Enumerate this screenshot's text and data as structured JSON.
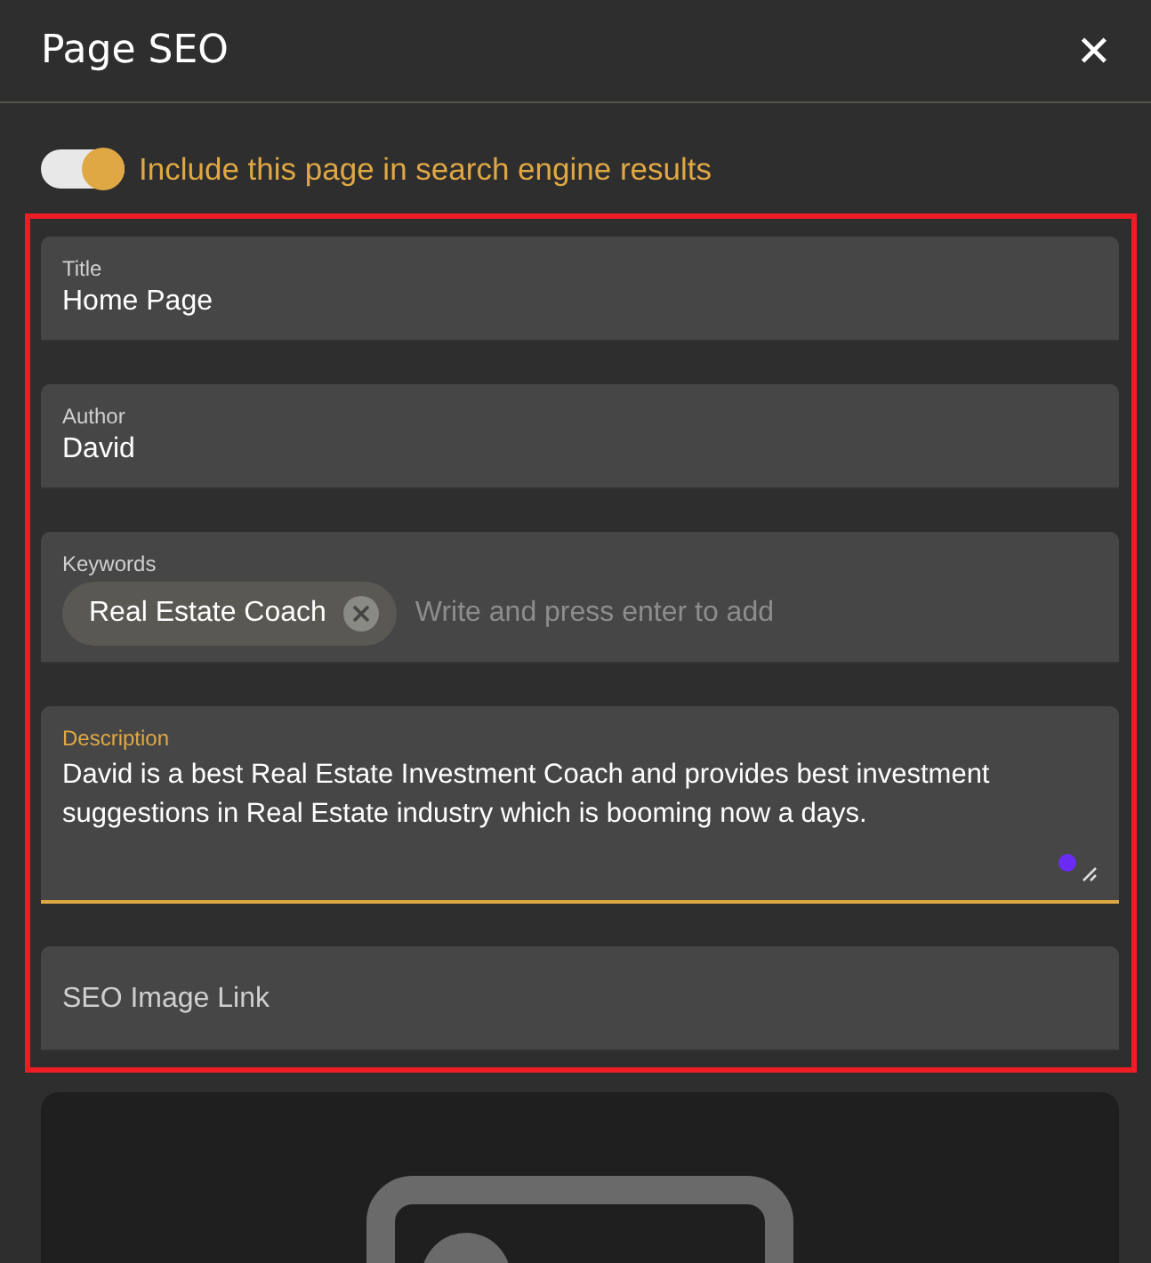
{
  "header": {
    "title": "Page SEO",
    "close": "✕"
  },
  "toggle": {
    "label": "Include this page in search engine results",
    "on": true
  },
  "fields": [
    {
      "kind": "text",
      "label": "Title",
      "value": "Home Page",
      "focused": false
    },
    {
      "kind": "text",
      "label": "Author",
      "value": "David",
      "focused": false
    },
    {
      "kind": "tags",
      "label": "Keywords",
      "tags": [
        "Real Estate Coach"
      ],
      "placeholder": "Write and press enter to add",
      "focused": false
    },
    {
      "kind": "textarea",
      "label": "Description",
      "value": "David is a best Real Estate Investment Coach and provides best investment suggestions in Real Estate industry which is booming now a days.",
      "focused": true
    },
    {
      "kind": "empty",
      "placeholder": "SEO Image Link",
      "focused": false
    }
  ]
}
